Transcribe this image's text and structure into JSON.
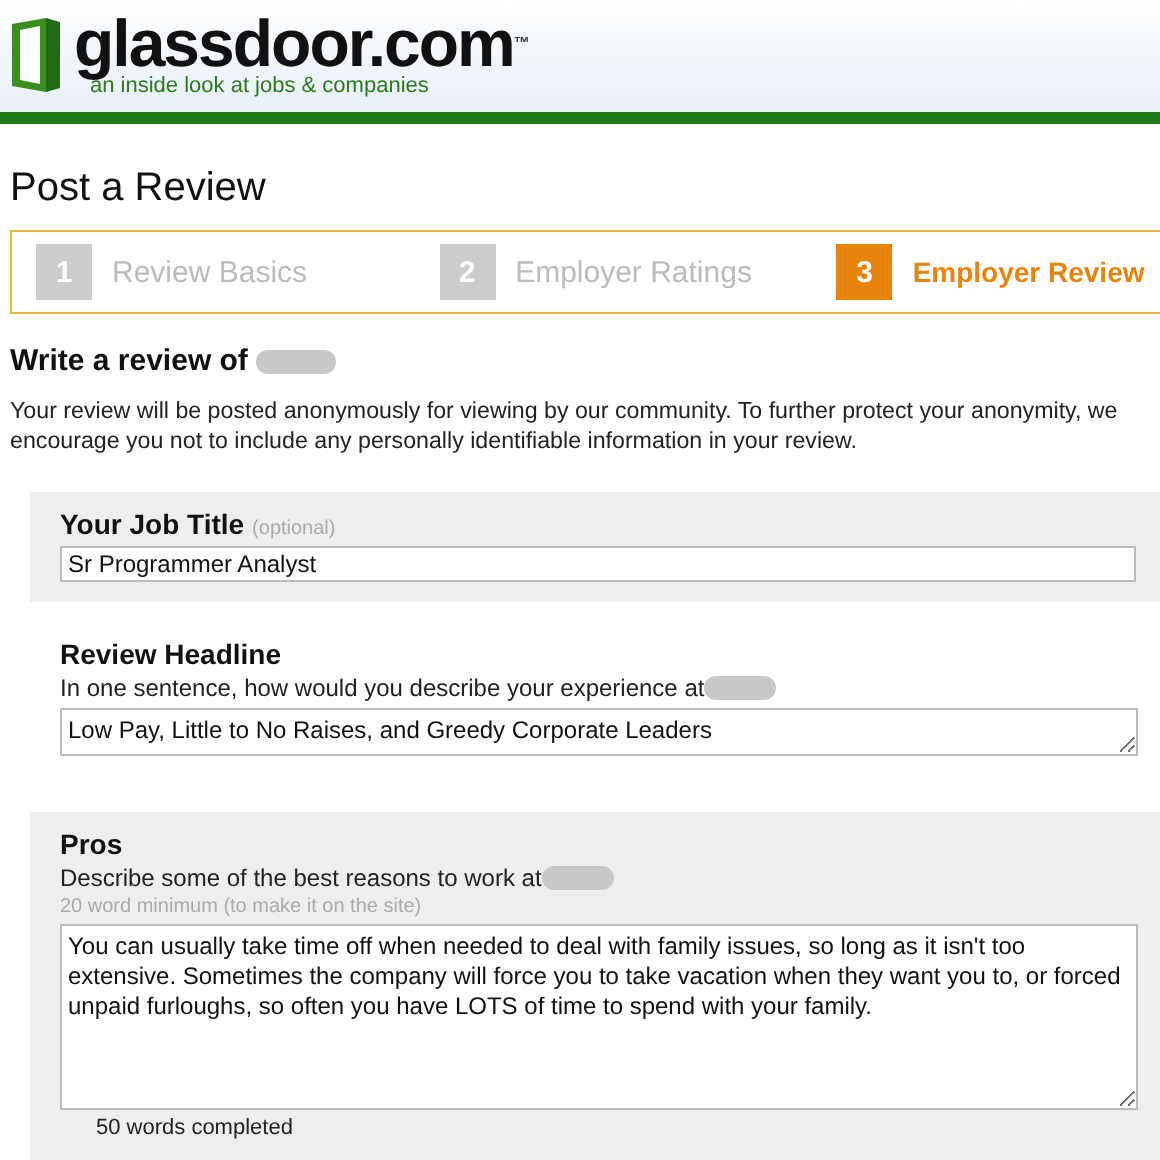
{
  "header": {
    "logo_text": "glassdoor.com",
    "trademark": "™",
    "tagline": "an inside look at jobs & companies"
  },
  "page_title": "Post a Review",
  "steps": [
    {
      "number": "1",
      "label": "Review Basics",
      "selected": false
    },
    {
      "number": "2",
      "label": "Employer Ratings",
      "selected": false
    },
    {
      "number": "3",
      "label": "Employer Review",
      "selected": true
    }
  ],
  "intro": {
    "heading": "Write a review of",
    "text": "Your review will be posted anonymously for viewing by our community. To further protect your anonymity, we encourage you not to include any personally identifiable information in your review."
  },
  "sections": [
    {
      "kind": "input",
      "shaded": true,
      "label": "Your Job Title",
      "optional_note": "(optional)",
      "value": "Sr Programmer Analyst"
    },
    {
      "kind": "textarea_short",
      "shaded": false,
      "label": "Review Headline",
      "prompt": "In one sentence, how would you describe your experience at",
      "value": "Low Pay, Little to No Raises, and Greedy Corporate Leaders"
    },
    {
      "kind": "textarea_long",
      "shaded": true,
      "label": "Pros",
      "prompt": "Describe some of the best reasons to work at",
      "hint": "20 word minimum (to make it on the site)",
      "value": "You can usually take time off when needed to deal with family issues, so long as it isn't too extensive. Sometimes the company will force you to take vacation when they want you to, or forced unpaid furloughs, so often you have LOTS of time to spend with your family.",
      "count": "50 words completed"
    }
  ]
}
